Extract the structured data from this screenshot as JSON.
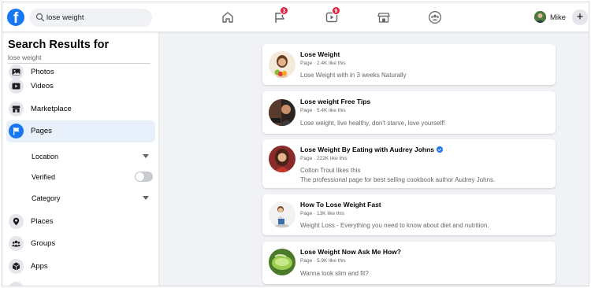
{
  "header": {
    "logo": "f",
    "search_value": "lose weight",
    "nav": [
      {
        "icon": "home-icon",
        "badge": ""
      },
      {
        "icon": "flag-icon",
        "badge": "3"
      },
      {
        "icon": "watch-video-icon",
        "badge": "9"
      },
      {
        "icon": "marketplace-store-icon",
        "badge": ""
      },
      {
        "icon": "groups-icon",
        "badge": ""
      }
    ],
    "profile_name": "Mike",
    "create_label": "+"
  },
  "sidebar": {
    "title": "Search Results for",
    "query": "lose weight",
    "items": [
      {
        "label": "Photos",
        "icon": "photo-icon"
      },
      {
        "label": "Videos",
        "icon": "video-icon"
      },
      {
        "label": "Marketplace",
        "icon": "store-icon"
      },
      {
        "label": "Pages",
        "icon": "flag-icon",
        "active": true
      },
      {
        "label": "Places",
        "icon": "location-pin-icon"
      },
      {
        "label": "Groups",
        "icon": "groups-icon"
      },
      {
        "label": "Apps",
        "icon": "cube-icon"
      }
    ],
    "filters": {
      "location_label": "Location",
      "verified_label": "Verified",
      "verified_on": false,
      "category_label": "Category"
    }
  },
  "results": [
    {
      "name": "Lose Weight",
      "meta": "Page · 2.4K like this",
      "lines": [
        "Lose Weight with in 3 weeks Naturally"
      ],
      "verified": false
    },
    {
      "name": "Lose weight Free Tips",
      "meta": "Page · 5.4K like this",
      "lines": [
        "Lose weight, live healthy, don't starve, love yourself!"
      ],
      "verified": false
    },
    {
      "name": "Lose Weight By Eating with Audrey Johns",
      "meta": "Page · 222K like this",
      "lines": [
        "Colton Trout likes this",
        "The professional page for best selling cookbook author Audrey Johns."
      ],
      "verified": true
    },
    {
      "name": "How To Lose Weight Fast",
      "meta": "Page · 13K like this",
      "lines": [
        "Weight Loss - Everything you need to know about diet and nutrition."
      ],
      "verified": false
    },
    {
      "name": "Lose Weight Now Ask Me How?",
      "meta": "Page · 5.9K like this",
      "lines": [
        "Wanna look slim and fit?"
      ],
      "verified": false
    }
  ],
  "colors": {
    "brand": "#1877f2",
    "badge": "#e41e3f",
    "active_bg": "#e7f0fb"
  }
}
